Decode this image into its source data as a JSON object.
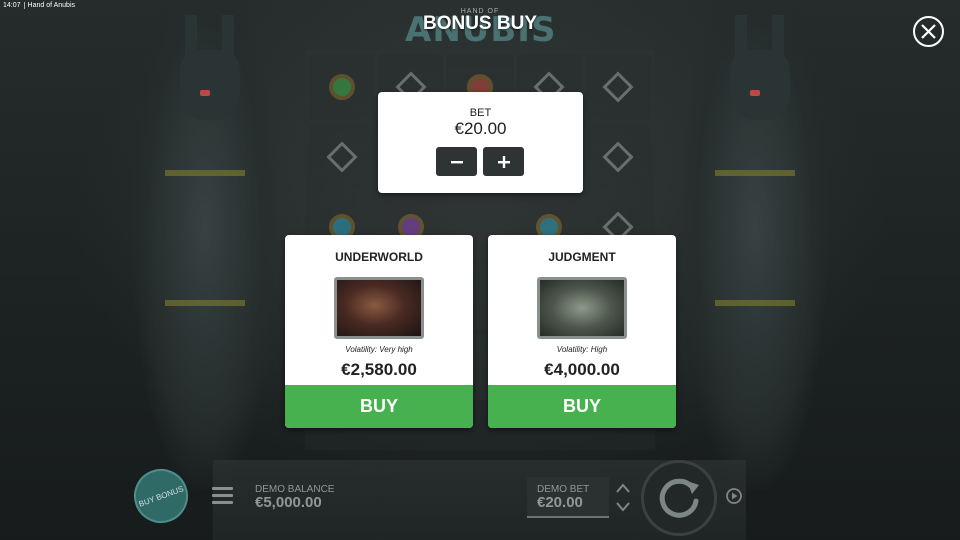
{
  "status_bar": {
    "time": "14:07",
    "app_name": "Hand of Anubis"
  },
  "header": {
    "logo_small": "HAND OF",
    "logo_big": "ANUBIS",
    "title": "BONUS BUY",
    "close_icon": "close-icon"
  },
  "bet_panel": {
    "label": "BET",
    "amount": "€20.00",
    "minus_icon": "minus-icon",
    "plus_icon": "plus-icon"
  },
  "cards": [
    {
      "title": "UNDERWORLD",
      "volatility": "Volatility: Very high",
      "price": "€2,580.00",
      "buy_label": "BUY"
    },
    {
      "title": "JUDGMENT",
      "volatility": "Volatility: High",
      "price": "€4,000.00",
      "buy_label": "BUY"
    }
  ],
  "footer": {
    "buy_bonus_label": "BUY BONUS",
    "balance_label": "DEMO BALANCE",
    "balance_value": "€5,000.00",
    "bet_label": "DEMO BET",
    "bet_value": "€20.00",
    "menu_icon": "hamburger-menu-icon",
    "spin_icon": "spin-icon",
    "autoplay_icon": "autoplay-icon"
  },
  "colors": {
    "buy_green": "#47b04f",
    "panel_white": "#ffffff",
    "step_button": "#2f3333",
    "background": "#1f2424"
  }
}
